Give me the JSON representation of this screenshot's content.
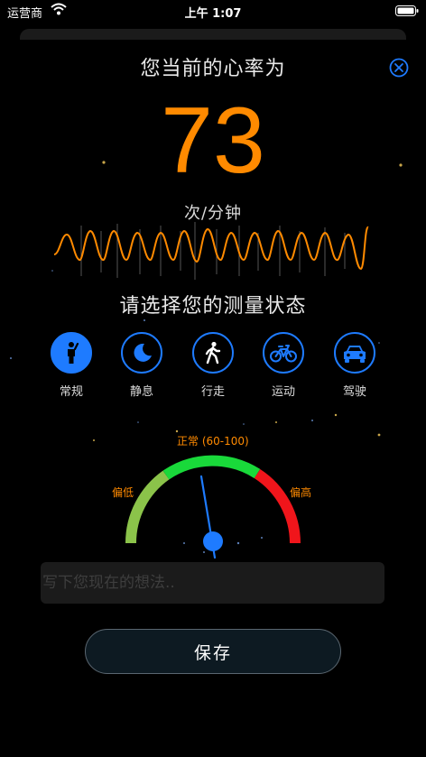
{
  "status_bar": {
    "carrier": "运营商",
    "time": "上午 1:07"
  },
  "header": {
    "title": "您当前的心率为"
  },
  "measurement": {
    "bpm": "73",
    "unit": "次/分钟"
  },
  "state_prompt": "请选择您的测量状态",
  "states": [
    {
      "label": "常规",
      "icon": "standing-person-icon",
      "selected": true
    },
    {
      "label": "静息",
      "icon": "moon-icon",
      "selected": false
    },
    {
      "label": "行走",
      "icon": "walking-person-icon",
      "selected": false
    },
    {
      "label": "运动",
      "icon": "bicycle-icon",
      "selected": false
    },
    {
      "label": "驾驶",
      "icon": "car-icon",
      "selected": false
    }
  ],
  "gauge": {
    "low_label": "偏低",
    "normal_label": "正常 (60-100)",
    "high_label": "偏高",
    "colors": {
      "low": "#8bc34a",
      "normal": "#19d93a",
      "high": "#f0151b",
      "needle": "#1e7bff"
    }
  },
  "note": {
    "placeholder": "写下您现在的想法.."
  },
  "save_label": "保存",
  "colors": {
    "accent": "#ff8a00",
    "primary_blue": "#1e7bff",
    "background": "#000000"
  }
}
